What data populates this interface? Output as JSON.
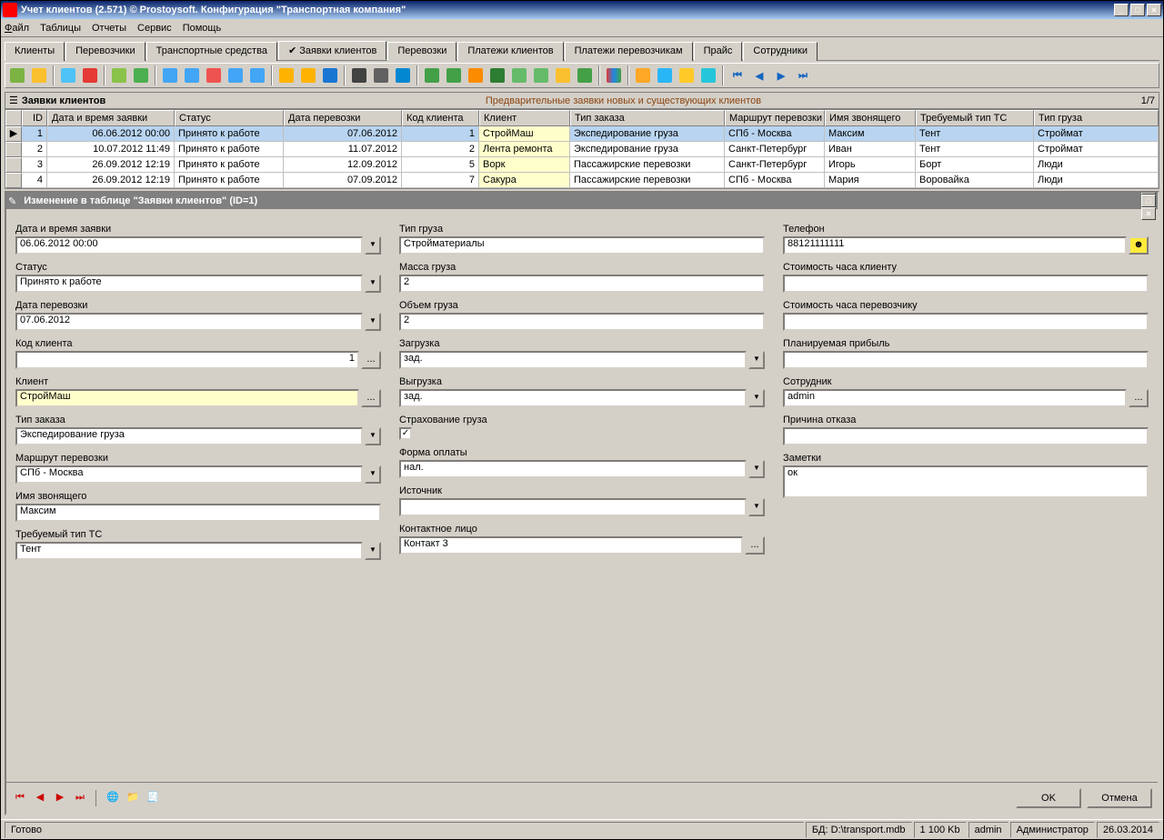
{
  "titlebar": {
    "title": "Учет клиентов (2.571) © Prostoysoft. Конфигурация \"Транспортная компания\""
  },
  "menu": {
    "file": "Файл",
    "tables": "Таблицы",
    "reports": "Отчеты",
    "service": "Сервис",
    "help": "Помощь"
  },
  "tabs": {
    "t1": "Клиенты",
    "t2": "Перевозчики",
    "t3": "Транспортные средства",
    "t4": "Заявки клиентов",
    "t5": "Перевозки",
    "t6": "Платежи клиентов",
    "t7": "Платежи перевозчикам",
    "t8": "Прайс",
    "t9": "Сотрудники"
  },
  "section": {
    "title": "Заявки клиентов",
    "subtitle": "Предварительные заявки новых и существующих клиентов",
    "counter": "1/7"
  },
  "grid": {
    "headers": {
      "id": "ID",
      "datetime": "Дата и время заявки",
      "status": "Статус",
      "shipdate": "Дата перевозки",
      "clientcode": "Код клиента",
      "client": "Клиент",
      "ordertype": "Тип заказа",
      "route": "Маршрут перевозки",
      "caller": "Имя звонящего",
      "vtype": "Требуемый тип ТС",
      "cargo": "Тип груза"
    },
    "rows": [
      {
        "id": "1",
        "dt": "06.06.2012 00:00",
        "st": "Принято к работе",
        "sd": "07.06.2012",
        "cc": "1",
        "cl": "СтройМаш",
        "ot": "Экспедирование груза",
        "rt": "СПб - Москва",
        "ca": "Максим",
        "vt": "Тент",
        "cg": "Строймат"
      },
      {
        "id": "2",
        "dt": "10.07.2012 11:49",
        "st": "Принято к работе",
        "sd": "11.07.2012",
        "cc": "2",
        "cl": "Лента ремонта",
        "ot": "Экспедирование груза",
        "rt": "Санкт-Петербург",
        "ca": "Иван",
        "vt": "Тент",
        "cg": "Строймат"
      },
      {
        "id": "3",
        "dt": "26.09.2012 12:19",
        "st": "Принято к работе",
        "sd": "12.09.2012",
        "cc": "5",
        "cl": "Ворк",
        "ot": "Пассажирские перевозки",
        "rt": "Санкт-Петербург",
        "ca": "Игорь",
        "vt": "Борт",
        "cg": "Люди"
      },
      {
        "id": "4",
        "dt": "26.09.2012 12:19",
        "st": "Принято к работе",
        "sd": "07.09.2012",
        "cc": "7",
        "cl": "Сакура",
        "ot": "Пассажирские перевозки",
        "rt": "СПб - Москва",
        "ca": "Мария",
        "vt": "Воровайка",
        "cg": "Люди"
      }
    ]
  },
  "subwin": {
    "title": "Изменение в таблице \"Заявки клиентов\" (ID=1)"
  },
  "form": {
    "col1": {
      "l_dt": "Дата и время заявки",
      "v_dt": "06.06.2012 00:00",
      "l_st": "Статус",
      "v_st": "Принято к работе",
      "l_sd": "Дата перевозки",
      "v_sd": "07.06.2012",
      "l_cc": "Код клиента",
      "v_cc": "1",
      "l_cl": "Клиент",
      "v_cl": "СтройМаш",
      "l_ot": "Тип заказа",
      "v_ot": "Экспедирование груза",
      "l_rt": "Маршрут перевозки",
      "v_rt": "СПб - Москва",
      "l_ca": "Имя звонящего",
      "v_ca": "Максим",
      "l_vt": "Требуемый тип ТС",
      "v_vt": "Тент"
    },
    "col2": {
      "l_cg": "Тип груза",
      "v_cg": "Стройматериалы",
      "l_ms": "Масса груза",
      "v_ms": "2",
      "l_vl": "Объем груза",
      "v_vl": "2",
      "l_ld": "Загрузка",
      "v_ld": "зад.",
      "l_ul": "Выгрузка",
      "v_ul": "зад.",
      "l_in": "Страхование груза",
      "l_pm": "Форма оплаты",
      "v_pm": "нал.",
      "l_sr": "Источник",
      "v_sr": "",
      "l_ct": "Контактное лицо",
      "v_ct": "Контакт 3"
    },
    "col3": {
      "l_ph": "Телефон",
      "v_ph": "88121111111",
      "l_c1": "Стоимость часа клиенту",
      "v_c1": "",
      "l_c2": "Стоимость часа перевозчику",
      "v_c2": "",
      "l_pr": "Планируемая прибыль",
      "v_pr": "",
      "l_em": "Сотрудник",
      "v_em": "admin",
      "l_rj": "Причина отказа",
      "v_rj": "",
      "l_nt": "Заметки",
      "v_nt": "ок"
    }
  },
  "buttons": {
    "ok": "OK",
    "cancel": "Отмена"
  },
  "status": {
    "ready": "Готово",
    "bd_label": "БД:",
    "bd": "D:\\transport.mdb",
    "size": "1 100 Kb",
    "user": "admin",
    "role": "Администратор",
    "date": "26.03.2014"
  }
}
